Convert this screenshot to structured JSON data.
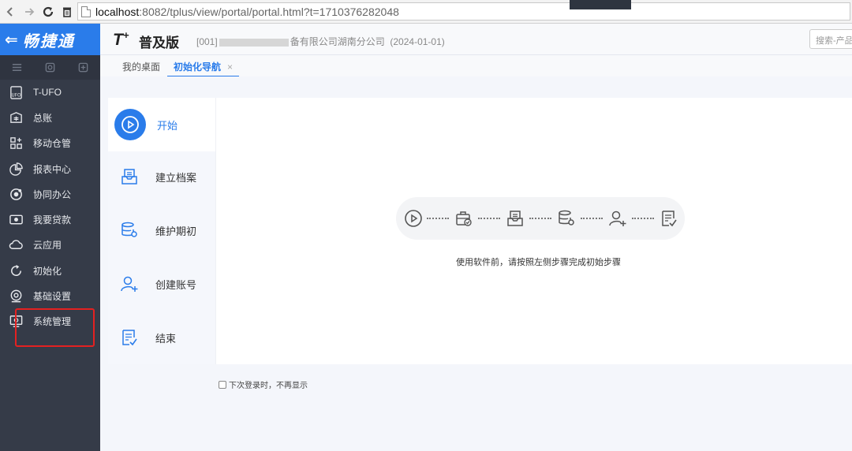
{
  "browser": {
    "url_host": "localhost",
    "url_rest": ":8082/tplus/view/portal/portal.html?t=1710376282048"
  },
  "header": {
    "logo_text": "畅捷通",
    "product_mark": "T",
    "product_sup": "+",
    "product_name": "普及版",
    "company_prefix": "[001]",
    "company_suffix": "备有限公司湖南分公司",
    "date": "(2024-01-01)",
    "search_placeholder": "搜索-产品"
  },
  "sidebar": {
    "items": [
      {
        "label": "T-UFO",
        "icon": "ufo-icon"
      },
      {
        "label": "总账",
        "icon": "ledger-icon"
      },
      {
        "label": "移动仓管",
        "icon": "grid-plus-icon"
      },
      {
        "label": "报表中心",
        "icon": "pie-chart-icon"
      },
      {
        "label": "协同办公",
        "icon": "collab-icon"
      },
      {
        "label": "我要贷款",
        "icon": "loan-icon"
      },
      {
        "label": "云应用",
        "icon": "cloud-icon"
      },
      {
        "label": "初始化",
        "icon": "refresh-icon"
      },
      {
        "label": "基础设置",
        "icon": "settings-icon"
      },
      {
        "label": "系统管理",
        "icon": "system-icon"
      }
    ]
  },
  "tabs": [
    {
      "label": "我的桌面"
    },
    {
      "label": "初始化导航",
      "close": "×"
    }
  ],
  "steps": [
    {
      "label": "开始",
      "active": true
    },
    {
      "label": "建立档案"
    },
    {
      "label": "维护期初"
    },
    {
      "label": "创建账号"
    },
    {
      "label": "结束"
    }
  ],
  "hint": "使用软件前，请按照左侧步骤完成初始步骤",
  "no_show_label": "下次登录时，不再显示",
  "colors": {
    "accent": "#2a7cea",
    "sidebar_bg": "#353b48",
    "highlight": "#e42121"
  }
}
